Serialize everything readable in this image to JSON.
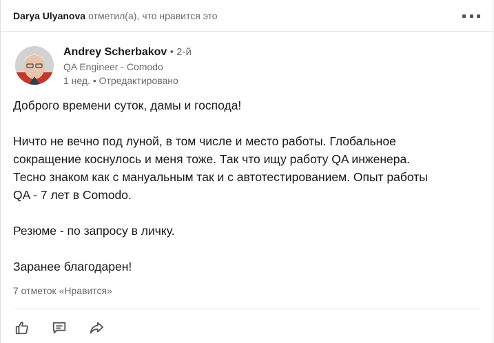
{
  "activity": {
    "actor": "Darya Ulyanova",
    "action": "отметил(а), что нравится это"
  },
  "author": {
    "name": "Andrey Scherbakov",
    "degree": "• 2-й",
    "headline": "QA Engineer - Comodo",
    "meta": "1 нед. • Отредактировано"
  },
  "post": {
    "line1": "Доброго времени суток, дамы и господа!",
    "para2_l1": "Ничто не вечно под луной, в том числе и место работы. Глобальное",
    "para2_l2": "сокращение коснулось и меня тоже. Так что ищу работу QA инженера.",
    "para2_l3": "Тесно знаком как с мануальным так и с автотестированием. Опыт работы",
    "para2_l4": "QA - 7 лет в Comodo.",
    "line3": "Резюме - по запросу в личку.",
    "line4": "Заранее благодарен!"
  },
  "likes_text": "7 отметок «Нравится»",
  "icons": {
    "menu": "more-options-icon",
    "like": "thumbs-up-icon",
    "comment": "comment-icon",
    "share": "share-icon"
  },
  "colors": {
    "text_primary": "#1a1a1a",
    "text_secondary": "#666666",
    "divider": "#e6e6e6",
    "icon": "#555555"
  }
}
